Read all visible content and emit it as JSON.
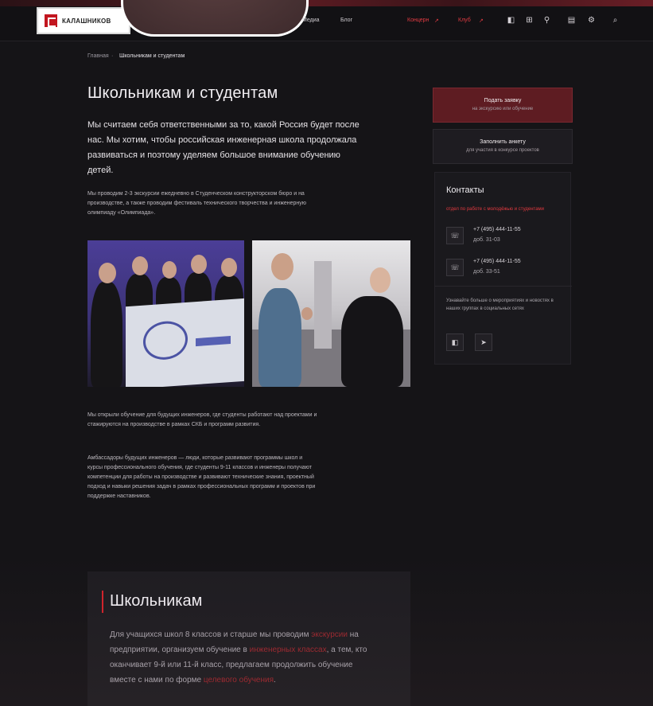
{
  "header": {
    "logo_text": "КАЛАШНИКОВ",
    "nav": [
      "Медиа",
      "Блог"
    ],
    "nav_red": [
      "Концерн",
      "Клуб"
    ],
    "icons": [
      "vk-icon",
      "ok-icon",
      "user-icon",
      "cart-icon",
      "settings-icon",
      "search-icon"
    ]
  },
  "breadcrumb": {
    "home": "Главная",
    "current": "Школьникам и студентам"
  },
  "page": {
    "title": "Школьникам и студентам",
    "lead": "Мы считаем себя ответственными за то, какой Россия будет после нас. Мы хотим, чтобы российская инженерная школа продолжала развиваться и поэтому уделяем большое внимание обучению детей.",
    "intro": "Мы проводим 2-3 экскурсии ежедневно в Студенческом конструкторском бюро и на производстве, а также проводим фестиваль технического творчества и инженерную олимпиаду «Олимпиада».",
    "body_1": "Мы открыли обучение для будущих инженеров, где студенты работают над проектами и стажируются на производстве в рамках СКБ и программ развития.",
    "body_2": "Амбассадоры будущих инженеров — люди, которые развивают программы школ и курсы профессионального обучения, где студенты 9-11 классов и инженеры получают компетенции для работы на производстве и развивают технические знания, проектный подход и навыки решения задач в рамках профессиональных программ и проектов при поддержке наставников."
  },
  "cards": {
    "primary_title": "Подать заявку",
    "primary_sub": "на экскурсию или обучение",
    "secondary_title": "Заполнить анкету",
    "secondary_sub": "для участия в конкурсе проектов"
  },
  "contacts": {
    "title": "Контакты",
    "link": "отдел по работе с молодёжью и студентами",
    "phones": [
      {
        "number": "+7 (495) 444-11-55",
        "ext": "доб. 31-03"
      },
      {
        "number": "+7 (495) 444-11-55",
        "ext": "доб. 33-51"
      }
    ],
    "note": "Узнавайте больше о мероприятиях и новостях в наших группах в социальных сетях",
    "socials": [
      "vk-icon",
      "telegram-icon"
    ]
  },
  "school": {
    "title": "Школьникам",
    "text_1": "Для учащихся школ 8 классов и старше мы проводим ",
    "hl_1": "экскурсии",
    "text_2": " на предприятии, организуем обучение в ",
    "hl_2": "инженерных классах",
    "text_3": ", а тем, кто оканчивает 9-й или 11-й класс, предлагаем продолжить обучение вместе с нами по форме ",
    "hl_3": "целевого обучения",
    "text_4": "."
  }
}
